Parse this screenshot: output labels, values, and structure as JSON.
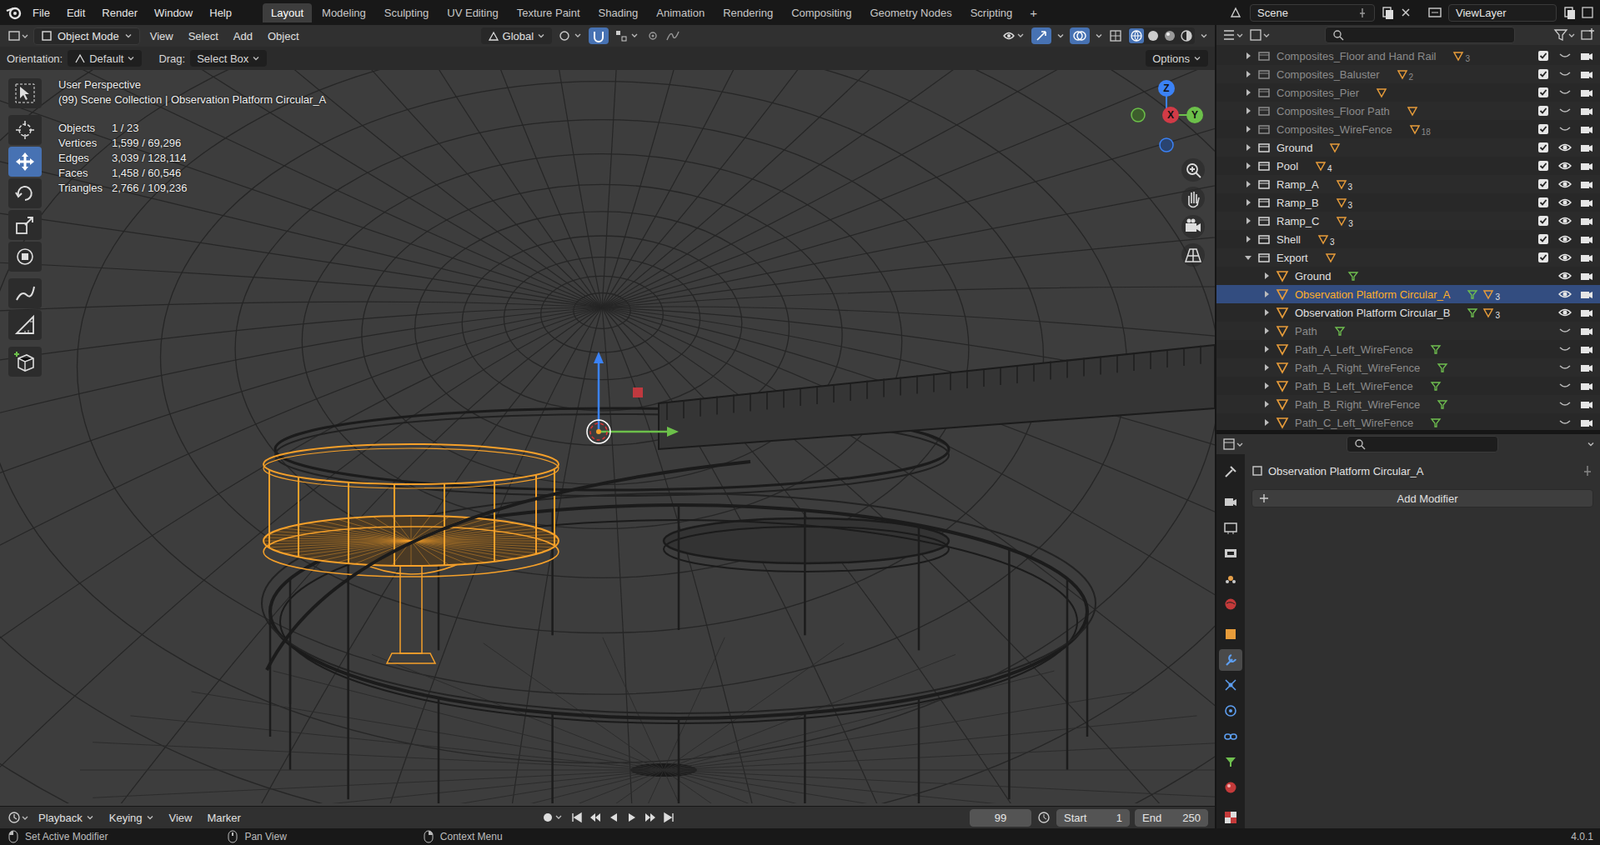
{
  "app_menu": [
    "File",
    "Edit",
    "Render",
    "Window",
    "Help"
  ],
  "workspaces": [
    {
      "label": "Layout",
      "selected": true
    },
    {
      "label": "Modeling",
      "selected": false
    },
    {
      "label": "Sculpting",
      "selected": false
    },
    {
      "label": "UV Editing",
      "selected": false
    },
    {
      "label": "Texture Paint",
      "selected": false
    },
    {
      "label": "Shading",
      "selected": false
    },
    {
      "label": "Animation",
      "selected": false
    },
    {
      "label": "Rendering",
      "selected": false
    },
    {
      "label": "Compositing",
      "selected": false
    },
    {
      "label": "Geometry Nodes",
      "selected": false
    },
    {
      "label": "Scripting",
      "selected": false
    }
  ],
  "add_workspace": "+",
  "scene": "Scene",
  "view_layer": "ViewLayer",
  "viewport_header": {
    "mode": "Object Mode",
    "menus": [
      "View",
      "Select",
      "Add",
      "Object"
    ],
    "orientation": "Global"
  },
  "tool_settings": {
    "orientation_label": "Orientation:",
    "orientation_value": "Default",
    "drag_label": "Drag:",
    "drag_value": "Select Box",
    "options": "Options"
  },
  "toolbar": [
    {
      "selected": false
    },
    {
      "selected": false
    },
    {
      "selected": true
    },
    {
      "selected": false
    },
    {
      "selected": false
    },
    {
      "selected": false
    },
    {
      "selected": false
    },
    {
      "selected": false
    },
    {
      "selected": false
    }
  ],
  "overlay": {
    "view": "User Perspective",
    "context": "(99) Scene Collection | Observation Platform Circular_A",
    "stats": [
      {
        "label": "Objects",
        "value": "1 / 23"
      },
      {
        "label": "Vertices",
        "value": "1,599 / 69,296"
      },
      {
        "label": "Edges",
        "value": "3,039 / 128,114"
      },
      {
        "label": "Faces",
        "value": "1,458 / 60,546"
      },
      {
        "label": "Triangles",
        "value": "2,766 / 109,236"
      }
    ]
  },
  "gizmo": {
    "x": "X",
    "y": "Y",
    "z": "Z"
  },
  "outliner": {
    "rows": [
      {
        "name": "Composites_Floor and Hand Rail",
        "depth": 1,
        "kind": "collection",
        "badge": "3",
        "visible": false,
        "selected": false,
        "expanded": false
      },
      {
        "name": "Composites_Baluster",
        "depth": 1,
        "kind": "collection",
        "badge": "2",
        "visible": false,
        "selected": false,
        "expanded": false
      },
      {
        "name": "Composites_Pier",
        "depth": 1,
        "kind": "collection",
        "badge": "",
        "visible": false,
        "selected": false,
        "expanded": false
      },
      {
        "name": "Composites_Floor Path",
        "depth": 1,
        "kind": "collection",
        "badge": "",
        "visible": false,
        "selected": false,
        "expanded": false
      },
      {
        "name": "Composites_WireFence",
        "depth": 1,
        "kind": "collection",
        "badge": "18",
        "visible": false,
        "selected": false,
        "expanded": false
      },
      {
        "name": "Ground",
        "depth": 1,
        "kind": "collection",
        "badge": "",
        "visible": true,
        "selected": false,
        "expanded": false
      },
      {
        "name": "Pool",
        "depth": 1,
        "kind": "collection",
        "badge": "4",
        "visible": true,
        "selected": false,
        "expanded": false
      },
      {
        "name": "Ramp_A",
        "depth": 1,
        "kind": "collection",
        "badge": "3",
        "visible": true,
        "selected": false,
        "expanded": false
      },
      {
        "name": "Ramp_B",
        "depth": 1,
        "kind": "collection",
        "badge": "3",
        "visible": true,
        "selected": false,
        "expanded": false
      },
      {
        "name": "Ramp_C",
        "depth": 1,
        "kind": "collection",
        "badge": "3",
        "visible": true,
        "selected": false,
        "expanded": false
      },
      {
        "name": "Shell",
        "depth": 1,
        "kind": "collection",
        "badge": "3",
        "visible": true,
        "selected": false,
        "expanded": false
      },
      {
        "name": "Export",
        "depth": 1,
        "kind": "collection",
        "badge": "",
        "visible": true,
        "selected": false,
        "expanded": true
      },
      {
        "name": "Ground",
        "depth": 2,
        "kind": "object",
        "badge": "",
        "visible": true,
        "selected": false,
        "expanded": false
      },
      {
        "name": "Observation Platform Circular_A",
        "depth": 2,
        "kind": "object",
        "badge": "3",
        "visible": true,
        "selected": true,
        "expanded": false
      },
      {
        "name": "Observation Platform Circular_B",
        "depth": 2,
        "kind": "object",
        "badge": "3",
        "visible": true,
        "selected": false,
        "expanded": false
      },
      {
        "name": "Path",
        "depth": 2,
        "kind": "object",
        "badge": "",
        "visible": false,
        "selected": false,
        "expanded": false
      },
      {
        "name": "Path_A_Left_WireFence",
        "depth": 2,
        "kind": "object",
        "badge": "",
        "visible": false,
        "selected": false,
        "expanded": false
      },
      {
        "name": "Path_A_Right_WireFence",
        "depth": 2,
        "kind": "object",
        "badge": "",
        "visible": false,
        "selected": false,
        "expanded": false
      },
      {
        "name": "Path_B_Left_WireFence",
        "depth": 2,
        "kind": "object",
        "badge": "",
        "visible": false,
        "selected": false,
        "expanded": false
      },
      {
        "name": "Path_B_Right_WireFence",
        "depth": 2,
        "kind": "object",
        "badge": "",
        "visible": false,
        "selected": false,
        "expanded": false
      },
      {
        "name": "Path_C_Left_WireFence",
        "depth": 2,
        "kind": "object",
        "badge": "",
        "visible": false,
        "selected": false,
        "expanded": false
      }
    ]
  },
  "properties": {
    "tabs": [
      {
        "selected": false
      },
      {
        "selected": false
      },
      {
        "selected": false
      },
      {
        "selected": false
      },
      {
        "selected": false
      },
      {
        "selected": false
      },
      {
        "selected": false
      },
      {
        "selected": true
      },
      {
        "selected": false
      },
      {
        "selected": false
      },
      {
        "selected": false
      },
      {
        "selected": false
      },
      {
        "selected": false
      },
      {
        "selected": false
      }
    ],
    "object": "Observation Platform Circular_A",
    "add_modifier": "Add Modifier"
  },
  "timeline": {
    "menus": [
      {
        "label": "Playback",
        "dropdown": true
      },
      {
        "label": "Keying",
        "dropdown": true
      },
      {
        "label": "View",
        "dropdown": false
      },
      {
        "label": "Marker",
        "dropdown": false
      }
    ],
    "frame": "99",
    "start_label": "Start",
    "start": "1",
    "end_label": "End",
    "end": "250"
  },
  "status_bar": {
    "items": [
      "Set Active Modifier",
      "Pan View",
      "Context Menu"
    ],
    "version": "4.0.1"
  }
}
